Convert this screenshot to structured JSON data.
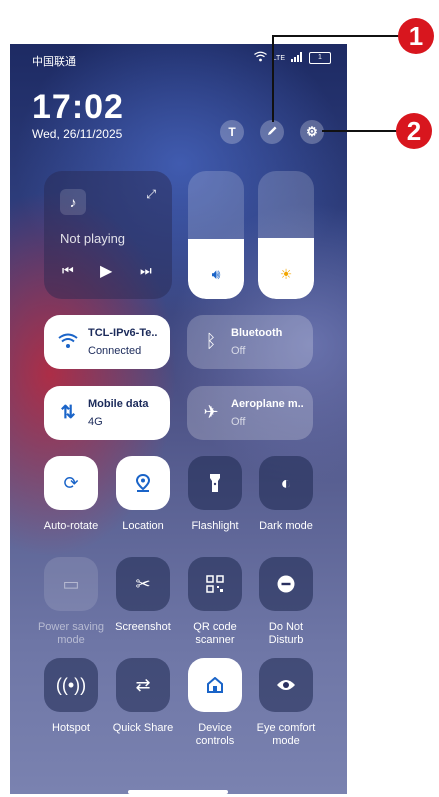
{
  "status_bar": {
    "carrier": "中国联通",
    "network": "LTE",
    "battery": "1"
  },
  "header": {
    "time": "17:02",
    "date": "Wed, 26/11/2025",
    "t_button": "T"
  },
  "media": {
    "status": "Not playing"
  },
  "brightness_level": 0.48,
  "volume_level": 0.47,
  "wifi": {
    "name": "TCL-IPv6-Te..",
    "status": "Connected"
  },
  "bluetooth": {
    "name": "Bluetooth",
    "status": "Off"
  },
  "mobile_data": {
    "name": "Mobile data",
    "status": "4G"
  },
  "aeroplane": {
    "name": "Aeroplane m..",
    "status": "Off"
  },
  "tiles": [
    {
      "label": "Auto-rotate",
      "icon": "auto-rotate-icon"
    },
    {
      "label": "Location",
      "icon": "location-icon"
    },
    {
      "label": "Flashlight",
      "icon": "flashlight-icon"
    },
    {
      "label": "Dark mode",
      "icon": "dark-mode-icon"
    },
    {
      "label": "Power saving mode",
      "icon": "battery-saver-icon"
    },
    {
      "label": "Screenshot",
      "icon": "screenshot-icon"
    },
    {
      "label": "QR code scanner",
      "icon": "qr-code-icon"
    },
    {
      "label": "Do Not Disturb",
      "icon": "do-not-disturb-icon"
    },
    {
      "label": "Hotspot",
      "icon": "hotspot-icon"
    },
    {
      "label": "Quick Share",
      "icon": "quick-share-icon"
    },
    {
      "label": "Device controls",
      "icon": "home-icon"
    },
    {
      "label": "Eye comfort mode",
      "icon": "eye-icon"
    }
  ],
  "callouts": [
    "1",
    "2"
  ],
  "colors": {
    "callout": "#d8161e",
    "active_blue": "#1a64c8"
  }
}
